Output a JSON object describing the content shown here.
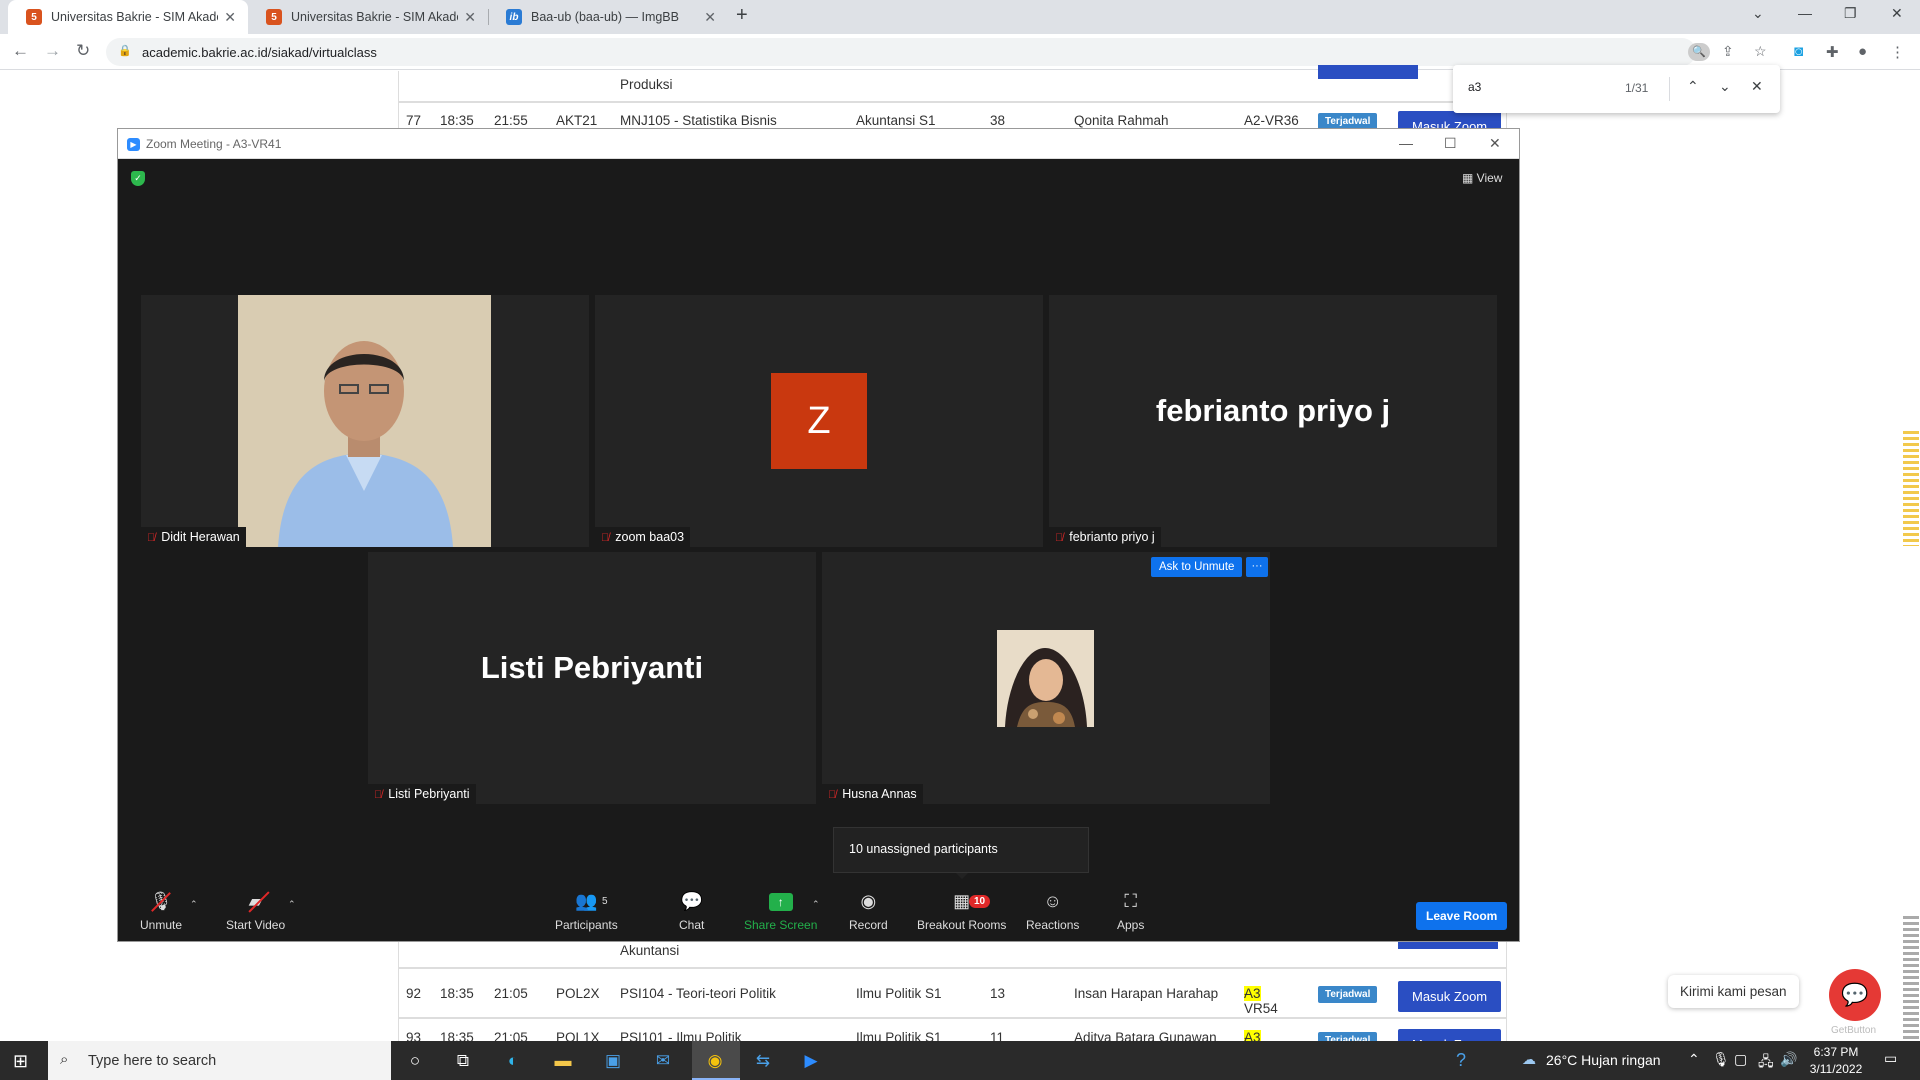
{
  "browser": {
    "tabs": [
      {
        "title": "Universitas Bakrie - SIM Akadem",
        "active": true
      },
      {
        "title": "Universitas Bakrie - SIM Akadem",
        "active": false
      },
      {
        "title": "Baa-ub (baa-ub) — ImgBB",
        "active": false
      }
    ],
    "url": "academic.bakrie.ac.id/siakad/virtualclass",
    "find": {
      "query": "a3",
      "count": "1/31"
    }
  },
  "page_rows": [
    {
      "no": "",
      "start": "",
      "end": "",
      "code": "",
      "course": "Produksi",
      "program": "",
      "count": "",
      "lecturer": "",
      "room_prefix": "",
      "room": ""
    },
    {
      "no": "77",
      "start": "18:35",
      "end": "21:55",
      "code": "AKT21",
      "course": "MNJ105 - Statistika Bisnis",
      "program": "Akuntansi S1",
      "count": "38",
      "lecturer": "Qonita Rahmah",
      "room_prefix": "",
      "room": "A2-VR36",
      "status": "Terjadwal",
      "action": "Masuk Zoom"
    },
    {
      "no": "",
      "start": "",
      "end": "",
      "code": "",
      "course": "Akuntansi",
      "program": "",
      "count": "",
      "lecturer": "",
      "room_prefix": "",
      "room": ""
    },
    {
      "no": "92",
      "start": "18:35",
      "end": "21:05",
      "code": "POL2X",
      "course": "PSI104 - Teori-teori Politik",
      "program": "Ilmu Politik S1",
      "count": "13",
      "lecturer": "Insan Harapan Harahap",
      "room_prefix": "A3",
      "room": "-VR54",
      "status": "Terjadwal",
      "action": "Masuk Zoom"
    },
    {
      "no": "93",
      "start": "18:35",
      "end": "21:05",
      "code": "POL1X",
      "course": "PSI101 - Ilmu Politik",
      "program": "Ilmu Politik S1",
      "count": "11",
      "lecturer": "Aditya Batara Gunawan",
      "room_prefix": "A3",
      "room": "-VR55",
      "status": "Terjadwal",
      "action": "Masuk Zoom"
    }
  ],
  "chat_widget": {
    "bubble": "Kirimi kami pesan",
    "brand": "GetButton"
  },
  "zoom": {
    "title": "Zoom Meeting - A3-VR41",
    "view_label": "View",
    "participants": [
      {
        "name": "Didit Herawan",
        "display": "photo"
      },
      {
        "name": "zoom baa03",
        "display": "Z"
      },
      {
        "name": "febrianto priyo j",
        "display": "febrianto priyo j"
      },
      {
        "name": "Listi Pebriyanti",
        "display": "Listi Pebriyanti"
      },
      {
        "name": "Husna Annas",
        "display": "photo"
      }
    ],
    "ask_to_unmute": "Ask to Unmute",
    "more_label": "···",
    "tooltip": "10 unassigned participants",
    "toolbar": {
      "unmute": "Unmute",
      "start_video": "Start Video",
      "participants": "Participants",
      "participants_count": "5",
      "chat": "Chat",
      "share_screen": "Share Screen",
      "record": "Record",
      "breakout_rooms": "Breakout Rooms",
      "breakout_count": "10",
      "reactions": "Reactions",
      "apps": "Apps",
      "leave_room": "Leave Room"
    }
  },
  "taskbar": {
    "search_placeholder": "Type here to search",
    "weather": "26°C  Hujan ringan",
    "time": "6:37 PM",
    "date": "3/11/2022"
  },
  "colors": {
    "zoom_blue": "#0e72ed",
    "share_green": "#23b04b",
    "badge_blue": "#3a87c9",
    "masuk_zoom": "#2a4ec2",
    "find_highlight": "#ffff00"
  }
}
